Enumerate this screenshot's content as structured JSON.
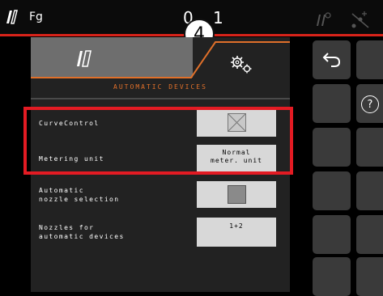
{
  "topbar": {
    "profile_label": "Fg",
    "time_left": "0",
    "time_right": "1",
    "callout_number": "4"
  },
  "panel": {
    "section_title": "AUTOMATIC DEVICES",
    "rows": [
      {
        "label": "CurveControl",
        "control": "checkbox",
        "checked": false
      },
      {
        "label": "Metering unit",
        "value": "Normal\nmeter. unit"
      },
      {
        "label": "Automatic\nnozzle selection",
        "control": "checkbox",
        "checked": false
      },
      {
        "label": "Nozzles for\nautomatic devices",
        "value": "1+2"
      }
    ]
  },
  "softkeys": {
    "help_label": "?"
  },
  "colors": {
    "accent_orange": "#e0702a",
    "highlight_red": "#e31b23",
    "statusbar_red": "#d8231a"
  },
  "icons": [
    "machine-icon",
    "gears-icon",
    "back-arrow-icon",
    "help-icon",
    "antenna-icon",
    "no-signal-icon"
  ]
}
